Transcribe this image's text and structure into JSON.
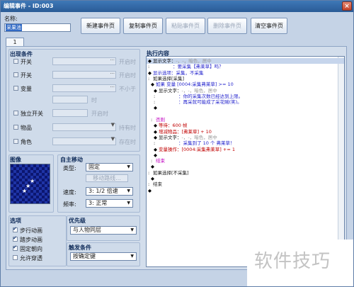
{
  "window": {
    "title": "编辑事件 - ID:003",
    "close": "×"
  },
  "name_label": "名称:",
  "name_value": "采果池",
  "toolbar": [
    {
      "label": "新建事件页",
      "enabled": true
    },
    {
      "label": "复制事件页",
      "enabled": true
    },
    {
      "label": "粘贴事件页",
      "enabled": false
    },
    {
      "label": "删除事件页",
      "enabled": false
    },
    {
      "label": "清空事件页",
      "enabled": true
    }
  ],
  "tab": "1",
  "conditions": {
    "title": "出现条件",
    "rows": [
      {
        "label": "开关",
        "suffix": "开启时"
      },
      {
        "label": "开关",
        "suffix": "开启时"
      },
      {
        "label": "变量",
        "suffix": "不小于"
      },
      {
        "label": "独立开关",
        "suffix": "开启时"
      },
      {
        "label": "物品",
        "suffix": "持有时"
      },
      {
        "label": "角色",
        "suffix": "存在时"
      }
    ]
  },
  "image": {
    "title": "图像"
  },
  "autonomous": {
    "title": "自主移动",
    "type_label": "类型:",
    "type_value": "固定",
    "route_button": "移动路线...",
    "speed_label": "速度:",
    "speed_value": "3: 1/2 倍速",
    "freq_label": "频率:",
    "freq_value": "3: 正常"
  },
  "options": {
    "title": "选项",
    "items": [
      {
        "label": "步行动画",
        "checked": true
      },
      {
        "label": "踏步动画",
        "checked": true
      },
      {
        "label": "固定朝向",
        "checked": true
      },
      {
        "label": "允许穿透",
        "checked": false
      }
    ]
  },
  "priority": {
    "title": "优先级",
    "value": "与人物同层"
  },
  "trigger": {
    "title": "触发条件",
    "value": "按确定键"
  },
  "exec": {
    "title": "执行内容",
    "lines": [
      {
        "m": "◆",
        "segs": [
          {
            "t": "显示文字：",
            "c": ""
          },
          {
            "t": "-，-，暗色，居中",
            "c": "cg"
          }
        ]
      },
      {
        "m": ":",
        "segs": [
          {
            "t": "　　　　 ：要采集【弗莱草】吗？",
            "c": "cb2"
          }
        ]
      },
      {
        "m": "◆",
        "segs": [
          {
            "t": "显示选项：采集，不采集",
            "c": "cb2"
          }
        ]
      },
      {
        "m": ":",
        "segs": [
          {
            "t": "如果选择[采集]",
            "c": ""
          }
        ]
      },
      {
        "m": "◆",
        "segs": [
          {
            "t": "如果 变量 [0004:采集弗莱草] >= 10",
            "c": "cb2"
          }
        ],
        "indent": 2
      },
      {
        "m": "◆",
        "segs": [
          {
            "t": "显示文字：",
            "c": ""
          },
          {
            "t": "-，-，暗色，居中",
            "c": "cg"
          }
        ],
        "indent": 3
      },
      {
        "m": ":",
        "segs": [
          {
            "t": "　　　　 ：你的采集次数已经达到上限。",
            "c": "cb2"
          }
        ],
        "indent": 3
      },
      {
        "m": ":",
        "segs": [
          {
            "t": "　　　　 ：再采就可能成了采花贼(笑)。",
            "c": "cb2"
          }
        ],
        "indent": 3
      },
      {
        "m": "◆",
        "segs": [],
        "indent": 3
      },
      {
        "m": "",
        "segs": [],
        "indent": 3
      },
      {
        "m": ":",
        "segs": [
          {
            "t": "否则",
            "c": "cp"
          }
        ],
        "indent": 2
      },
      {
        "m": "◆",
        "segs": [
          {
            "t": "等待：600 帧",
            "c": "cr"
          }
        ],
        "indent": 3
      },
      {
        "m": "◆",
        "segs": [
          {
            "t": "增减物品：[弗莱草] + 10",
            "c": "cr"
          }
        ],
        "indent": 3
      },
      {
        "m": "◆",
        "segs": [
          {
            "t": "显示文字：",
            "c": ""
          },
          {
            "t": "-，-，暗色，居中",
            "c": "cg"
          }
        ],
        "indent": 3
      },
      {
        "m": ":",
        "segs": [
          {
            "t": "　　　　 ：采集到了 10 个 弗莱草！",
            "c": "cb2"
          }
        ],
        "indent": 3
      },
      {
        "m": "◆",
        "segs": [
          {
            "t": "变量操作：[0004:采集弗莱草] += 1",
            "c": "cr"
          }
        ],
        "indent": 3
      },
      {
        "m": "◆",
        "segs": [],
        "indent": 3
      },
      {
        "m": ":",
        "segs": [
          {
            "t": "结束",
            "c": "cp"
          }
        ],
        "indent": 2
      },
      {
        "m": "◆",
        "segs": [],
        "indent": 2
      },
      {
        "m": ":",
        "segs": [
          {
            "t": "如果选择[不采集]",
            "c": ""
          }
        ]
      },
      {
        "m": "◆",
        "segs": [],
        "indent": 2
      },
      {
        "m": ":",
        "segs": [
          {
            "t": "结束",
            "c": ""
          }
        ]
      },
      {
        "m": "◆",
        "segs": []
      }
    ]
  },
  "watermark": "软件技巧"
}
